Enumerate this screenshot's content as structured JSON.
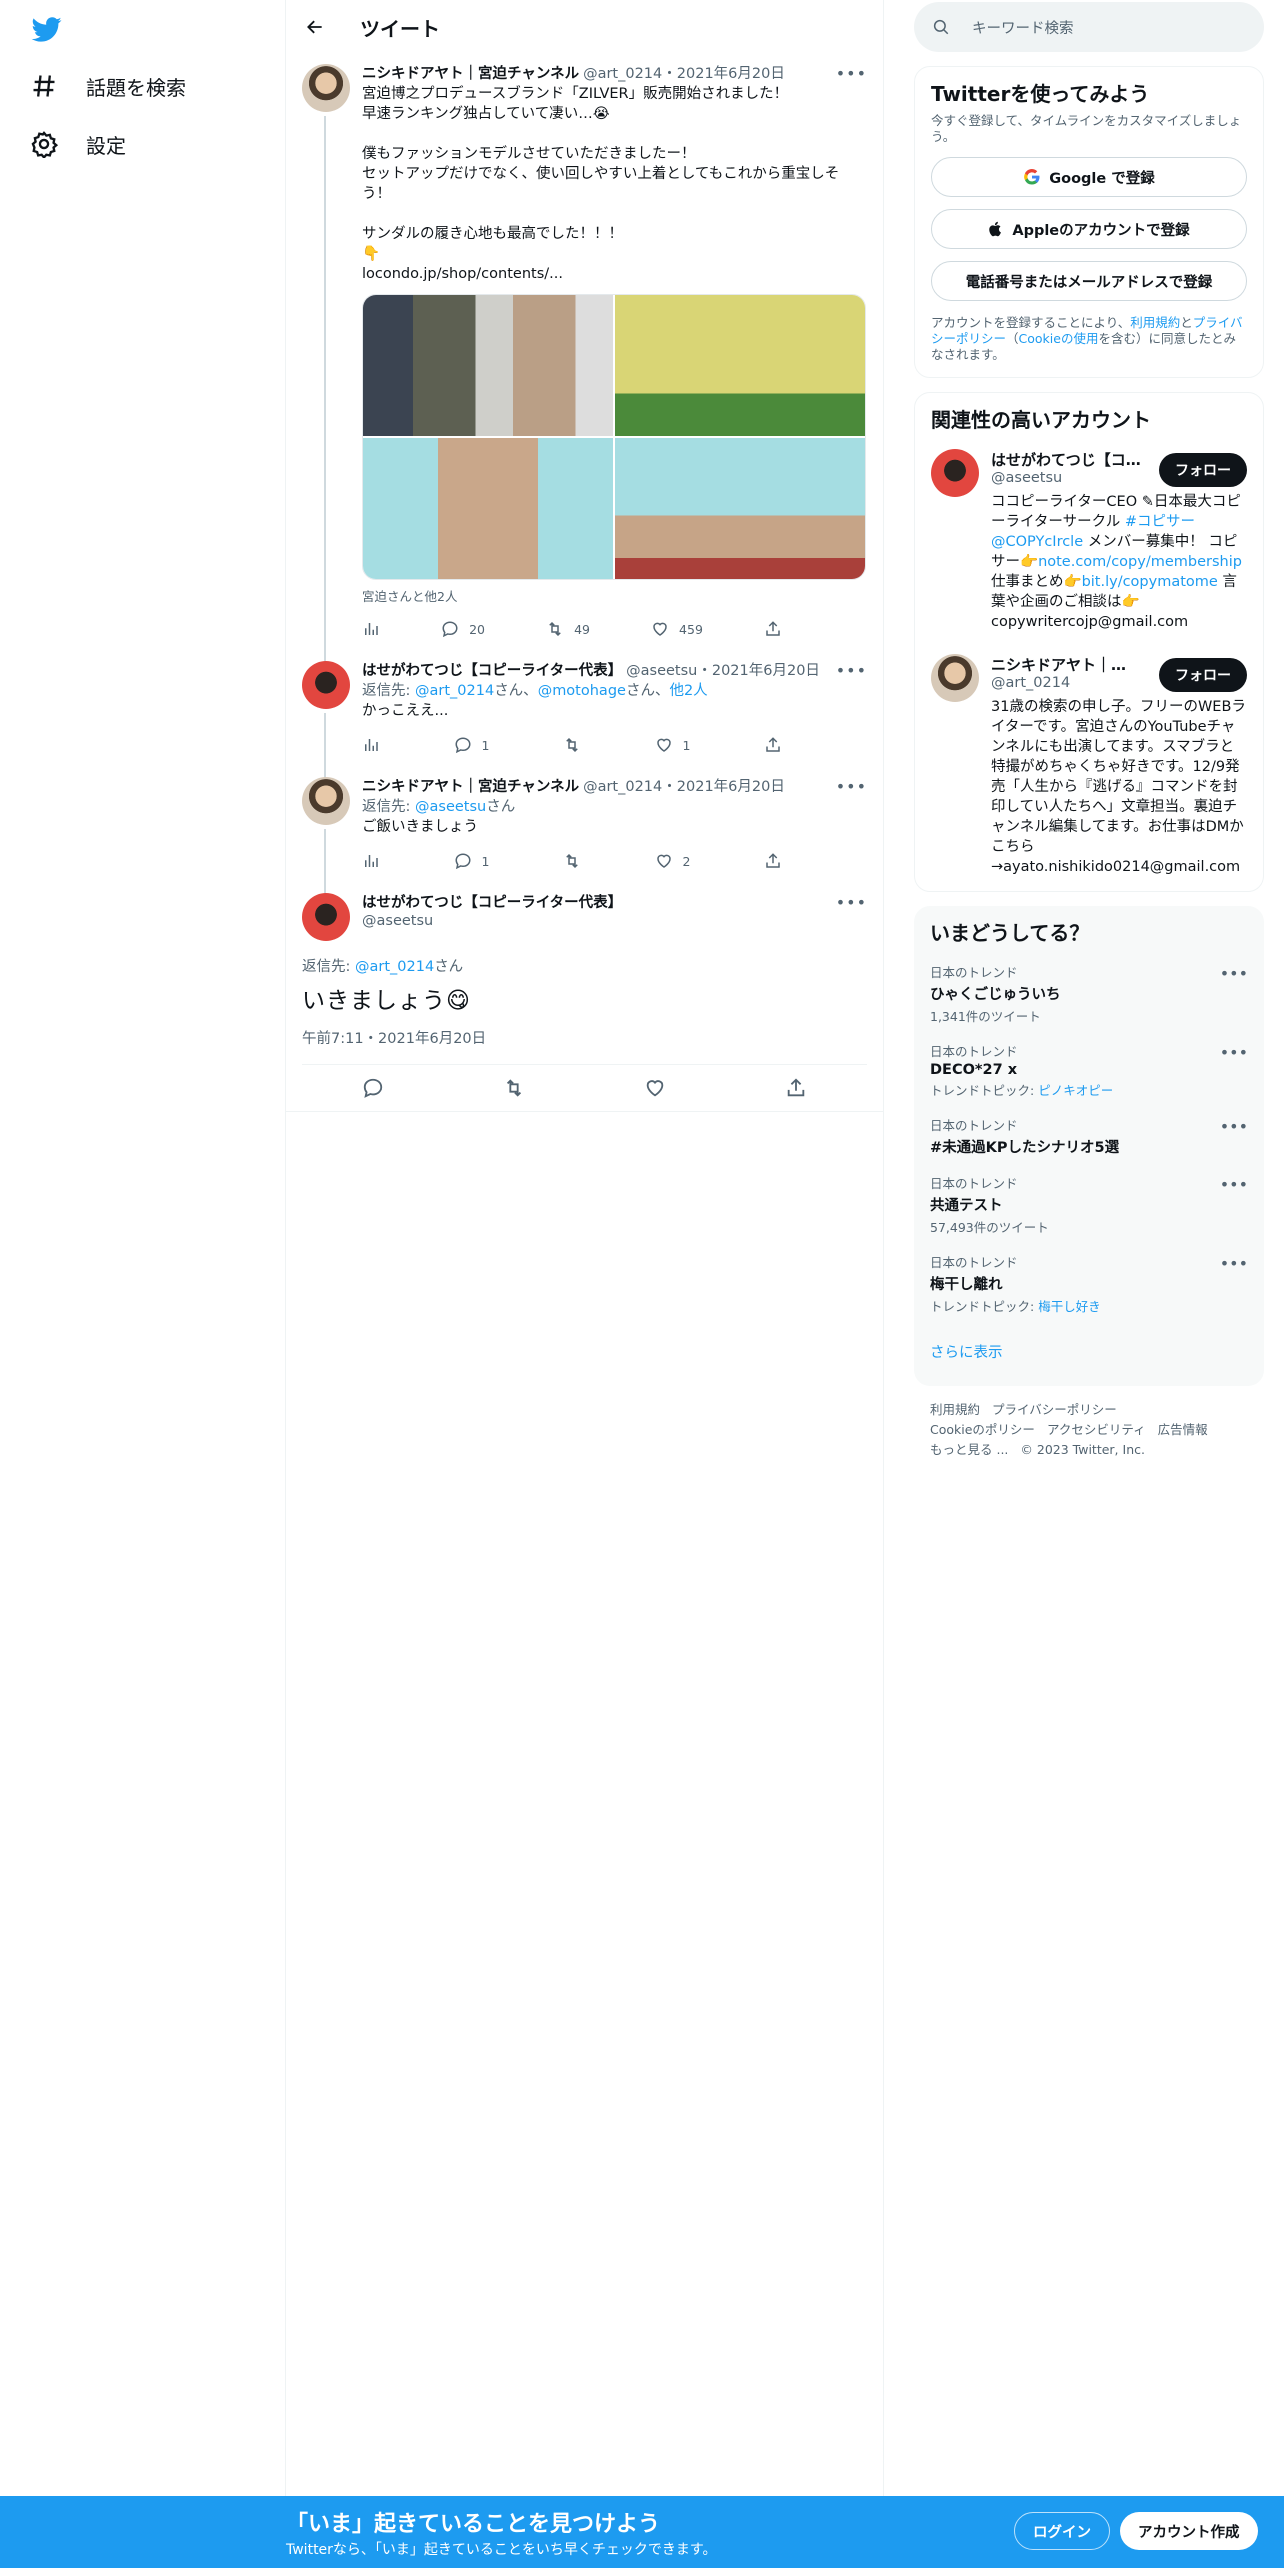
{
  "nav": {
    "explore_label": "話題を検索",
    "settings_label": "設定"
  },
  "header": {
    "title": "ツイート"
  },
  "tweets": [
    {
      "name": "ニシキドアヤト｜宮迫チャンネル",
      "handle": "@art_0214",
      "date": "・2021年6月20日",
      "body": "宮迫博之プロデュースブランド「ZILVER」販売開始されました！\n早速ランキング独占していて凄い…😭\n\n僕もファッションモデルさせていただきましたー！\nセットアップだけでなく、使い回しやすい上着としてもこれから重宝しそう！\n\nサンダルの履き心地も最高でした！！！\n👇",
      "link": "locondo.jp/shop/contents/...",
      "media_caption": "宮迫さんと他2人",
      "stats": {
        "views": "",
        "replies": "20",
        "retweets": "49",
        "likes": "459"
      }
    },
    {
      "name": "はせがわてつじ【コピーライター代表】",
      "handle": "@aseetsu",
      "date": "・2021年6月20日",
      "reply_prefix": "返信先: ",
      "reply_user1": "@art_0214",
      "reply_sep1": "さん、",
      "reply_user2": "@motohage",
      "reply_sep2": "さん、",
      "reply_others": "他2人",
      "body": "かっこええ...",
      "stats": {
        "replies": "1",
        "retweets": "",
        "likes": "1"
      }
    },
    {
      "name": "ニシキドアヤト｜宮迫チャンネル",
      "handle": "@art_0214",
      "date": "・2021年6月20日",
      "reply_prefix": "返信先: ",
      "reply_user1": "@aseetsu",
      "reply_sep1": "さん",
      "body": "ご飯いきましょう",
      "stats": {
        "replies": "1",
        "retweets": "",
        "likes": "2"
      }
    }
  ],
  "focus": {
    "name": "はせがわてつじ【コピーライター代表】",
    "handle": "@aseetsu",
    "reply_prefix": "返信先: ",
    "reply_user": "@art_0214",
    "reply_suffix": "さん",
    "body": "いきましょう😋",
    "timestamp": "午前7:11・2021年6月20日"
  },
  "search": {
    "placeholder": "キーワード検索"
  },
  "signup_card": {
    "title": "Twitterを使ってみよう",
    "subtitle": "今すぐ登録して、タイムラインをカスタマイズしましょう。",
    "google_btn": "Google で登録",
    "apple_btn": "Appleのアカウントで登録",
    "phone_btn": "電話番号またはメールアドレスで登録",
    "terms_pre": "アカウントを登録することにより、",
    "terms_link1": "利用規約",
    "terms_and": "と",
    "terms_link2": "プライバシーポリシー",
    "terms_mid": "（",
    "terms_link3": "Cookieの使用",
    "terms_post": "を含む）に同意したとみなされます。"
  },
  "related": {
    "title": "関連性の高いアカウント",
    "follow_label": "フォロー",
    "accounts": [
      {
        "name": "はせがわてつじ【コピーライター代表】",
        "handle": "@aseetsu",
        "bio_1": "ココピーライターCEO ✎日本最大コピーライターサークル ",
        "bio_link1": "#コピサー",
        "bio_2": " ",
        "bio_link2": "@COPYcIrcle",
        "bio_3": " メンバー募集中！ コピサー👉",
        "bio_link3": "note.com/copy/membership",
        "bio_4": " 仕事まとめ👉",
        "bio_link4": "bit.ly/copymatome",
        "bio_5": " 言葉や企画のご相談は👉 copywritercojp@gmail.com"
      },
      {
        "name": "ニシキドアヤト｜宮迫チャンネル",
        "handle": "@art_0214",
        "bio": "31歳の検索の申し子。フリーのWEBライターです。宮迫さんのYouTubeチャンネルにも出演してます。スマブラと特撮がめちゃくちゃ好きです。12/9発売「人生から『逃げる』コマンドを封印してい人たちへ」文章担当。裏迫チャンネル編集してます。お仕事はDMかこちら→ayato.nishikido0214@gmail.com"
      }
    ]
  },
  "trends": {
    "title": "いまどうしてる？",
    "items": [
      {
        "category": "日本のトレンド",
        "name": "ひゃくごじゅういち",
        "meta": "1,341件のツイート"
      },
      {
        "category": "日本のトレンド",
        "name": "DECO*27 x",
        "meta_prefix": "トレンドトピック: ",
        "meta_link": "ピノキオピー"
      },
      {
        "category": "日本のトレンド",
        "name": "#未通過KPしたシナリオ5選"
      },
      {
        "category": "日本のトレンド",
        "name": "共通テスト",
        "meta": "57,493件のツイート"
      },
      {
        "category": "日本のトレンド",
        "name": "梅干し離れ",
        "meta_prefix": "トレンドトピック: ",
        "meta_link": "梅干し好き"
      }
    ],
    "show_more": "さらに表示"
  },
  "footer": {
    "terms": "利用規約",
    "privacy": "プライバシーポリシー",
    "cookie": "Cookieのポリシー",
    "accessibility": "アクセシビリティ",
    "ads": "広告情報",
    "more": "もっと見る ...",
    "copyright": "© 2023 Twitter, Inc."
  },
  "bottombar": {
    "title": "「いま」起きていることを見つけよう",
    "subtitle": "Twitterなら、「いま」起きていることをいち早くチェックできます。",
    "login": "ログイン",
    "signup": "アカウント作成"
  },
  "colors": {
    "accent": "#1d9bf0",
    "text": "#0f1419",
    "muted": "#536471"
  }
}
